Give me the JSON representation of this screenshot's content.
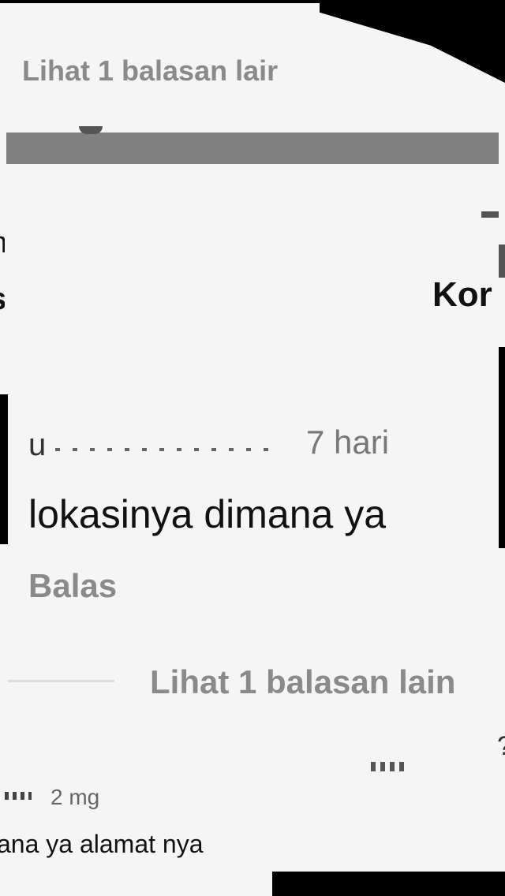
{
  "top_card": {
    "view_more_replies": "Lihat 1 balasan lair"
  },
  "side_fragments": {
    "right_heading_cut": "Kor",
    "left_sliver": "s",
    "left_sliver_2": "n",
    "right_question_cut": "?"
  },
  "main_comment": {
    "username_cut": "u",
    "timestamp": "7 hari",
    "body": "lokasinya dimana ya",
    "reply_label": "Balas",
    "view_more_replies": "Lihat 1 balasan lain"
  },
  "bottom_card": {
    "timestamp": "2 mg",
    "body_cut": "ana ya alamat nya"
  },
  "colors": {
    "background": "#f5f5f5",
    "black_overlay": "#000000",
    "gray_bar": "#808080",
    "muted_text": "#8a8a8a"
  }
}
